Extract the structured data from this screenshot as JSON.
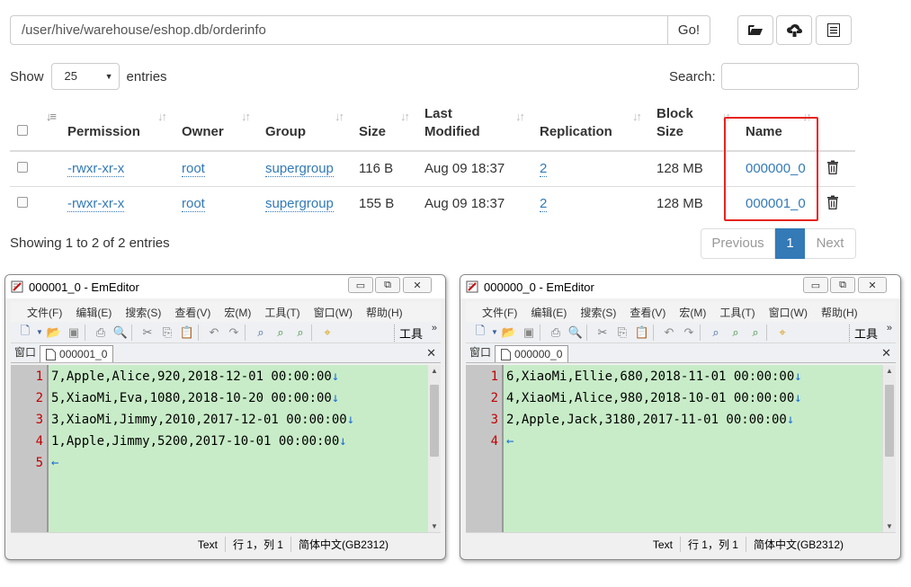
{
  "pathbar": {
    "path": "/user/hive/warehouse/eshop.db/orderinfo",
    "go_label": "Go!"
  },
  "toolbar_icons": [
    "folder-icon",
    "upload-icon",
    "list-icon"
  ],
  "show": {
    "prefix": "Show",
    "value": "25",
    "suffix": "entries"
  },
  "search": {
    "label": "Search:"
  },
  "table": {
    "headers": [
      "Permission",
      "Owner",
      "Group",
      "Size",
      "Last Modified",
      "Replication",
      "Block Size",
      "Name"
    ],
    "rows": [
      {
        "permission": "-rwxr-xr-x",
        "owner": "root",
        "group": "supergroup",
        "size": "116 B",
        "modified": "Aug 09 18:37",
        "replication": "2",
        "block_size": "128 MB",
        "name": "000000_0"
      },
      {
        "permission": "-rwxr-xr-x",
        "owner": "root",
        "group": "supergroup",
        "size": "155 B",
        "modified": "Aug 09 18:37",
        "replication": "2",
        "block_size": "128 MB",
        "name": "000001_0"
      }
    ]
  },
  "footer": {
    "showing": "Showing 1 to 2 of 2 entries",
    "previous": "Previous",
    "page": "1",
    "next": "Next"
  },
  "highlight_color": "#e8231f",
  "accent_color": "#337ab7",
  "editors": [
    {
      "title": "000001_0 - EmEditor",
      "menu": [
        "文件(F)",
        "编辑(E)",
        "搜索(S)",
        "查看(V)",
        "宏(M)",
        "工具(T)",
        "窗口(W)",
        "帮助(H)"
      ],
      "tools_label": "工具",
      "window_label": "窗口",
      "tab": "000001_0",
      "line_numbers": [
        "1",
        "2",
        "3",
        "4",
        "5"
      ],
      "lines": [
        "7,Apple,Alice,920,2018-12-01 00:00:00",
        "5,XiaoMi,Eva,1080,2018-10-20 00:00:00",
        "3,XiaoMi,Jimmy,2010,2017-12-01 00:00:00",
        "1,Apple,Jimmy,5200,2017-10-01 00:00:00",
        ""
      ],
      "status": [
        "Text",
        "行 1，列 1",
        "简体中文(GB2312)"
      ]
    },
    {
      "title": "000000_0 - EmEditor",
      "menu": [
        "文件(F)",
        "编辑(E)",
        "搜索(S)",
        "查看(V)",
        "宏(M)",
        "工具(T)",
        "窗口(W)",
        "帮助(H)"
      ],
      "tools_label": "工具",
      "window_label": "窗口",
      "tab": "000000_0",
      "line_numbers": [
        "1",
        "2",
        "3",
        "4"
      ],
      "lines": [
        "6,XiaoMi,Ellie,680,2018-11-01 00:00:00",
        "4,XiaoMi,Alice,980,2018-10-01 00:00:00",
        "2,Apple,Jack,3180,2017-11-01 00:00:00",
        ""
      ],
      "status": [
        "Text",
        "行 1，列 1",
        "简体中文(GB2312)"
      ]
    }
  ]
}
